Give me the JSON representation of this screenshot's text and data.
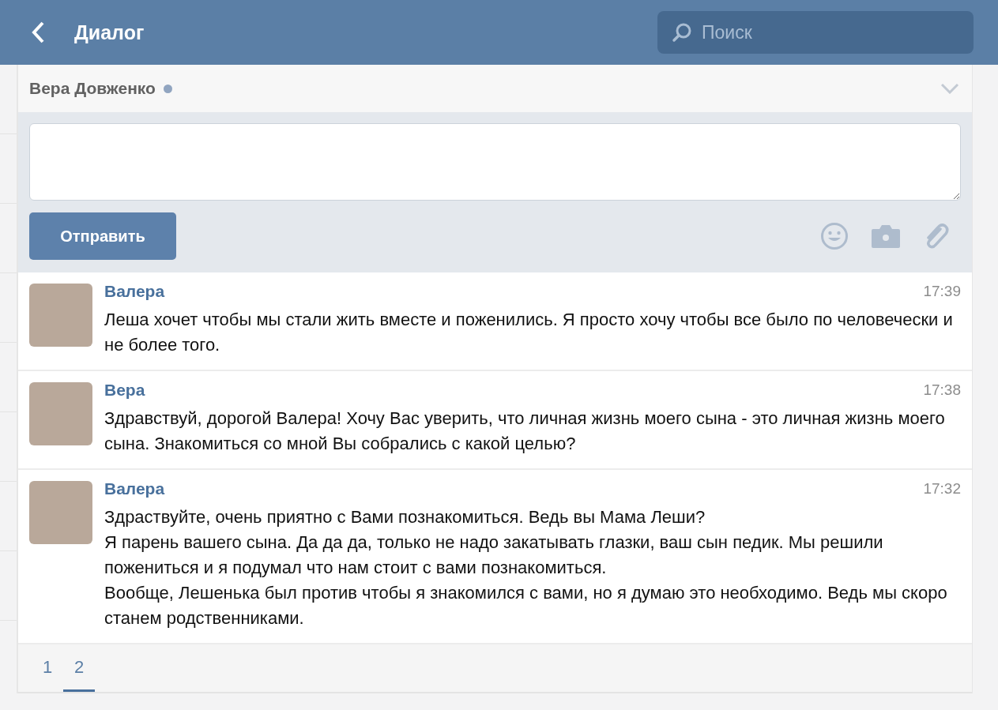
{
  "header": {
    "title": "Диалог",
    "search": {
      "placeholder": "Поиск"
    }
  },
  "dialog": {
    "name": "Вера Довженко",
    "online": true,
    "expanded": false
  },
  "compose": {
    "send_label": "Отправить"
  },
  "messages": [
    {
      "author": "Валера",
      "time": "17:39",
      "paragraphs": [
        "Леша хочет чтобы мы стали жить вместе и поженились. Я просто хочу чтобы все было по человечески и не более того."
      ]
    },
    {
      "author": "Вера",
      "time": "17:38",
      "paragraphs": [
        "Здравствуй, дорогой Валера! Хочу Вас уверить, что личная жизнь моего сына - это личная жизнь моего сына. Знакомиться со мной Вы собрались с какой целью?"
      ]
    },
    {
      "author": "Валера",
      "time": "17:32",
      "paragraphs": [
        "Здраствуйте, очень приятно с Вами познакомиться. Ведь вы Мама Леши?",
        "Я парень вашего сына. Да да да, только не надо закатывать глазки, ваш сын педик. Мы решили пожениться и я подумал что нам стоит с вами познакомиться.",
        "Вообще, Лешенька был против чтобы я знакомился с вами, но я думаю это необходимо. Ведь мы скоро станем родственниками."
      ]
    }
  ],
  "pages": [
    {
      "label": "1",
      "selected": false
    },
    {
      "label": "2",
      "selected": true
    }
  ]
}
